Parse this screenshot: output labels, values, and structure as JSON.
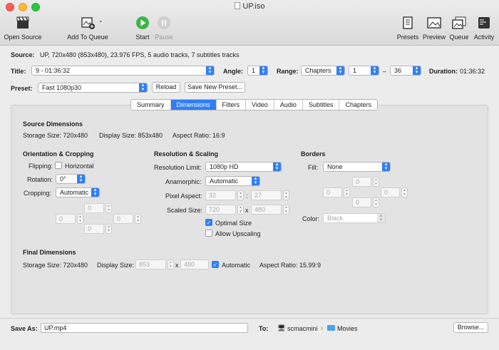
{
  "window": {
    "title": "UP.iso"
  },
  "toolbar": {
    "open_source": "Open Source",
    "add_to_queue": "Add To Queue",
    "start": "Start",
    "pause": "Pause",
    "presets": "Presets",
    "preview": "Preview",
    "queue": "Queue",
    "activity": "Activity"
  },
  "source": {
    "label": "Source:",
    "value": "UP, 720x480 (853x480), 23.976 FPS, 5 audio tracks, 7 subtitles tracks"
  },
  "title_row": {
    "title_label": "Title:",
    "title_value": "9 - 01:36:32",
    "angle_label": "Angle:",
    "angle_value": "1",
    "range_label": "Range:",
    "range_type": "Chapters",
    "range_start": "1",
    "range_dash": "–",
    "range_end": "36",
    "duration_label": "Duration:",
    "duration_value": "01:36:32"
  },
  "preset_row": {
    "label": "Preset:",
    "value": "Fast 1080p30",
    "reload": "Reload",
    "save_new": "Save New Preset..."
  },
  "tabs": [
    "Summary",
    "Dimensions",
    "Filters",
    "Video",
    "Audio",
    "Subtitles",
    "Chapters"
  ],
  "selected_tab": "Dimensions",
  "source_dimensions": {
    "heading": "Source Dimensions",
    "storage_size": "Storage Size: 720x480",
    "display_size": "Display Size: 853x480",
    "aspect_ratio": "Aspect Ratio: 16:9"
  },
  "orientation": {
    "heading": "Orientation & Cropping",
    "flipping_label": "Flipping:",
    "horizontal": "Horizontal",
    "rotation_label": "Rotation:",
    "rotation_value": "0°",
    "cropping_label": "Cropping:",
    "cropping_value": "Automatic",
    "crop_top": "0",
    "crop_left": "0",
    "crop_right": "0",
    "crop_bottom": "0"
  },
  "resolution": {
    "heading": "Resolution & Scaling",
    "limit_label": "Resolution Limit:",
    "limit_value": "1080p HD",
    "anamorphic_label": "Anamorphic:",
    "anamorphic_value": "Automatic",
    "pixel_aspect_label": "Pixel Aspect:",
    "pixel_aspect_w": "32",
    "colon": ":",
    "pixel_aspect_h": "27",
    "scaled_label": "Scaled Size:",
    "scaled_w": "720",
    "x": "x",
    "scaled_h": "480",
    "optimal": "Optimal Size",
    "upscaling": "Allow Upscaling"
  },
  "borders": {
    "heading": "Borders",
    "fill_label": "Fill:",
    "fill_value": "None",
    "top": "0",
    "left": "0",
    "right": "0",
    "bottom": "0",
    "color_label": "Color:",
    "color_value": "Black"
  },
  "final_dimensions": {
    "heading": "Final Dimensions",
    "storage_size": "Storage Size: 720x480",
    "display_label": "Display Size:",
    "display_w": "853",
    "x": "x",
    "display_h": "480",
    "automatic": "Automatic",
    "aspect_ratio": "Aspect Ratio: 15.99:9"
  },
  "save": {
    "label": "Save As:",
    "value": "UP.mp4",
    "to_label": "To:",
    "computer": "scmacmini",
    "separator": "›",
    "folder": "Movies",
    "browse": "Browse..."
  },
  "colors": {
    "accent": "#2f7ff5",
    "start_green": "#3db34a"
  }
}
